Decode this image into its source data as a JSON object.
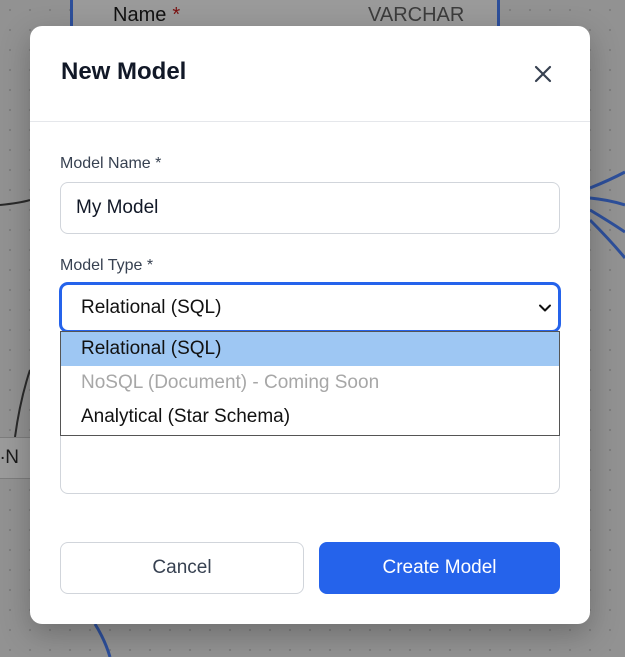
{
  "background": {
    "table_field": {
      "name": "Name",
      "required_marker": "*",
      "type": "VARCHAR"
    },
    "node_label": "∙N"
  },
  "modal": {
    "title": "New Model",
    "close_icon": "close-icon",
    "model_name": {
      "label": "Model Name *",
      "value": "My Model",
      "placeholder": ""
    },
    "model_type": {
      "label": "Model Type *",
      "selected": "Relational (SQL)",
      "options": [
        {
          "label": "Relational (SQL)",
          "state": "highlighted"
        },
        {
          "label": "NoSQL (Document) - Coming Soon",
          "state": "disabled"
        },
        {
          "label": "Analytical (Star Schema)",
          "state": "enabled"
        }
      ]
    },
    "buttons": {
      "cancel": "Cancel",
      "create": "Create Model"
    }
  },
  "colors": {
    "primary": "#2563eb",
    "option_highlight": "#9ec7f3",
    "disabled_text": "#a7a7a7"
  }
}
